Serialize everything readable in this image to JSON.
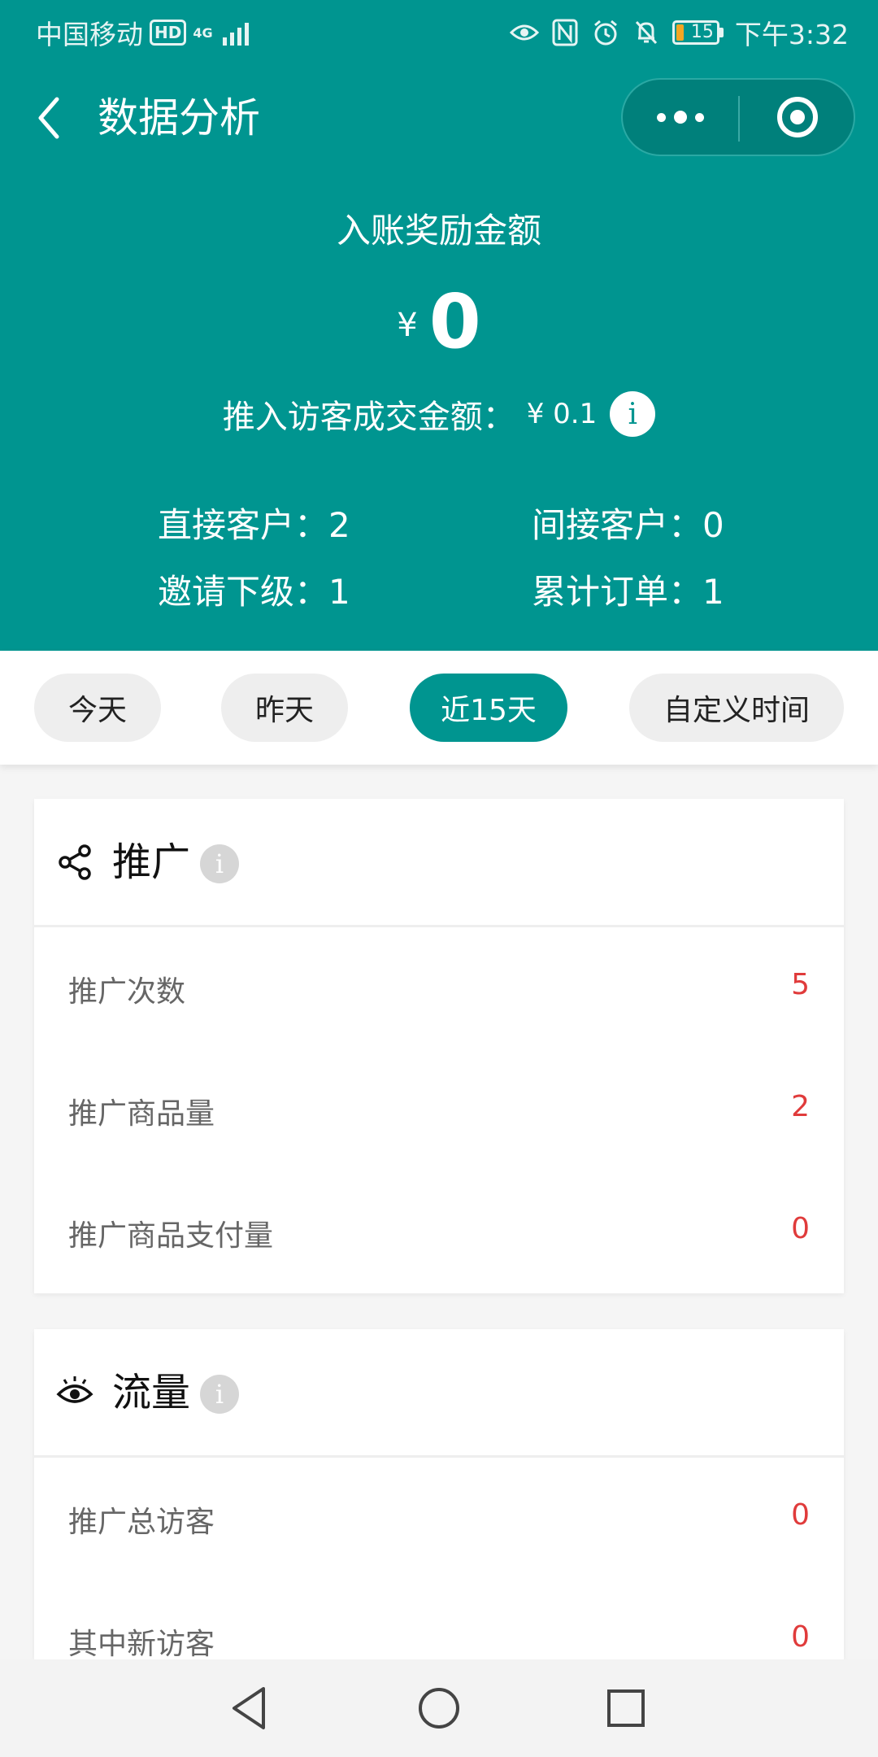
{
  "status_bar": {
    "carrier": "中国移动",
    "hd": "HD",
    "network": "4G",
    "battery": "15",
    "time": "下午3:32"
  },
  "nav": {
    "title": "数据分析"
  },
  "summary": {
    "reward_label": "入账奖励金额",
    "currency": "¥",
    "reward_amount": "0",
    "pushin_label": "推入访客成交金额：",
    "pushin_value": "¥ 0.1",
    "stats": {
      "direct": "直接客户：2",
      "indirect": "间接客户：0",
      "invite": "邀请下级：1",
      "orders": "累计订单：1"
    }
  },
  "filters": [
    {
      "label": "今天",
      "active": false
    },
    {
      "label": "昨天",
      "active": false
    },
    {
      "label": "近15天",
      "active": true
    },
    {
      "label": "自定义时间",
      "active": false
    }
  ],
  "sections": [
    {
      "title": "推广",
      "icon": "share-icon",
      "rows": [
        {
          "label": "推广次数",
          "value": "5"
        },
        {
          "label": "推广商品量",
          "value": "2"
        },
        {
          "label": "推广商品支付量",
          "value": "0"
        }
      ]
    },
    {
      "title": "流量",
      "icon": "eye-icon",
      "rows": [
        {
          "label": "推广总访客",
          "value": "0"
        },
        {
          "label": "其中新访客",
          "value": "0"
        }
      ]
    }
  ],
  "info_glyph": "i",
  "colors": {
    "primary": "#009590",
    "value_red": "#e03b3b",
    "chip_bg": "#eeeeee"
  }
}
